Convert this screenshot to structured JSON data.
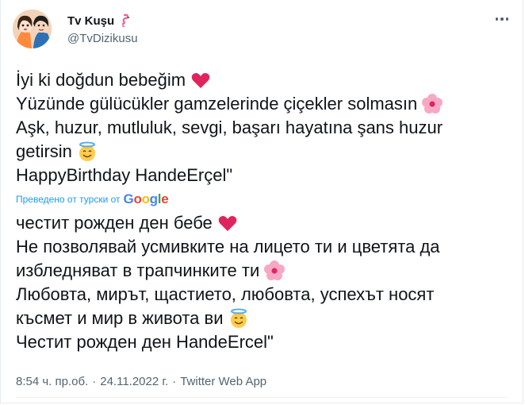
{
  "user": {
    "name": "Tv Kuşu",
    "handle": "@TvDizikusu",
    "name_icon": "flamingo-icon",
    "avatar_icon": "avatar-illustration"
  },
  "tweet": {
    "lines": [
      "İyi ki doğdun bebeğim",
      "Yüzünde gülücükler gamzelerinde çiçekler solmasın",
      "Aşk, huzur, mutluluk, sevgi, başarı hayatına şans huzur",
      "getirsin",
      "HappyBirthday HandeErçel\""
    ],
    "emojis": [
      "red-heart-emoji",
      "flower-emoji",
      "",
      "smiling-halo-emoji",
      ""
    ]
  },
  "translation_note": {
    "text": "Преведено от турски от",
    "provider": "Google"
  },
  "translation": {
    "lines": [
      "честит рожден ден бебе",
      "Не позволявай усмивките на лицето ти и цветята да",
      "избледняват в трапчинките ти",
      "Любовта, мирът, щастието, любовта, успехът носят",
      "късмет и мир в живота ви",
      "Честит рожден ден HandeErcel\""
    ],
    "emojis": [
      "red-heart-emoji",
      "",
      "flower-emoji",
      "",
      "smiling-halo-emoji",
      ""
    ]
  },
  "meta": {
    "time": "8:54 ч. пр.об.",
    "sep1": "·",
    "date": "24.11.2022 г.",
    "sep2": "·",
    "source": "Twitter Web App"
  },
  "colors": {
    "link": "#1d9bf0",
    "secondary": "#536471",
    "heart": "#e0245e"
  }
}
